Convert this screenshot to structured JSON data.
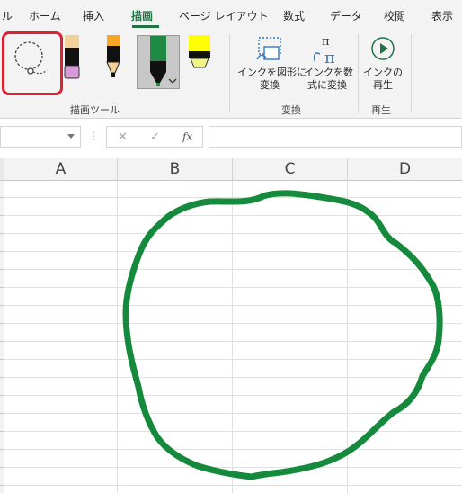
{
  "tabs": [
    {
      "label": "ル"
    },
    {
      "label": "ホーム"
    },
    {
      "label": "挿入"
    },
    {
      "label": "描画",
      "active": true
    },
    {
      "label": "ページ レイアウト"
    },
    {
      "label": "数式"
    },
    {
      "label": "データ"
    },
    {
      "label": "校閲"
    },
    {
      "label": "表示"
    }
  ],
  "ribbon": {
    "groups": [
      {
        "label": "描画ツール"
      },
      {
        "label": "変換"
      },
      {
        "label": "再生"
      }
    ],
    "buttons": {
      "ink_to_shape": "インクを図形に\n変換",
      "ink_to_math": "インクを数\n式に変換",
      "ink_replay": "インクの\n再生"
    },
    "icons": {
      "lasso": "lasso-select-icon",
      "pen_black_pink": "pen-icon",
      "pen_black": "pen-icon",
      "pen_orange": "pen-icon",
      "pen_green": "pen-icon",
      "highlighter_yellow": "highlighter-icon",
      "ink_to_shape": "ink-to-shape-icon",
      "ink_to_math": "ink-to-math-icon",
      "replay": "ink-replay-icon"
    },
    "selected_pen_color": "#1e8a44",
    "highlight_color": "#e02131"
  },
  "formula_bar": {
    "cancel_symbol": "✕",
    "enter_symbol": "✓",
    "fx_symbol": "fx",
    "dots": "⋮"
  },
  "columns": [
    "A",
    "B",
    "C",
    "D"
  ],
  "ink": {
    "color": "#158a3c"
  }
}
